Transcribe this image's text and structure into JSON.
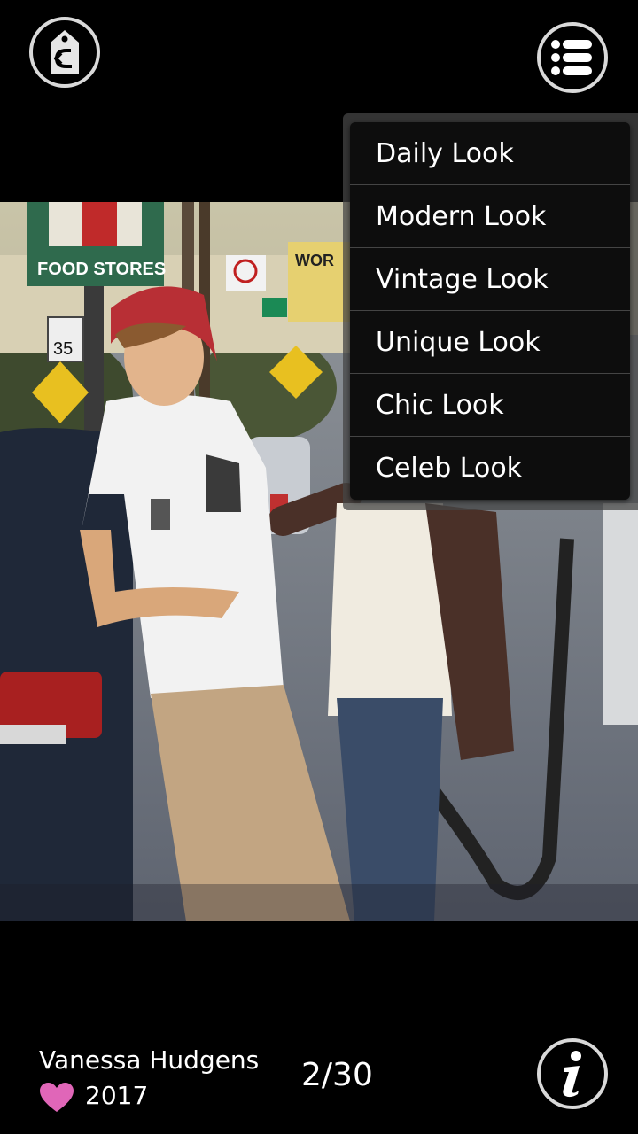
{
  "header": {
    "back_icon": "back-tag-icon",
    "menu_icon": "list-menu-icon"
  },
  "menu": {
    "items": [
      {
        "label": "Daily Look"
      },
      {
        "label": "Modern Look"
      },
      {
        "label": "Vintage Look"
      },
      {
        "label": "Unique Look"
      },
      {
        "label": "Chic Look"
      },
      {
        "label": "Celeb Look"
      }
    ]
  },
  "photo": {
    "signs": {
      "store": "FOOD STORES",
      "speed": "35",
      "work": "WOR"
    }
  },
  "footer": {
    "name": "Vanessa Hudgens",
    "year": "2017",
    "counter": "2/30",
    "info_icon": "info-icon",
    "heart_icon": "heart-icon",
    "heart_color": "#e066b8"
  }
}
